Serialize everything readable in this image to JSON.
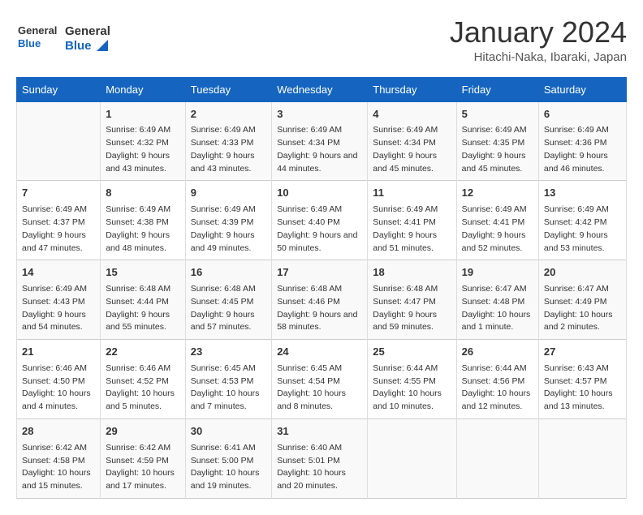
{
  "header": {
    "logo_general": "General",
    "logo_blue": "Blue",
    "month": "January 2024",
    "location": "Hitachi-Naka, Ibaraki, Japan"
  },
  "days_of_week": [
    "Sunday",
    "Monday",
    "Tuesday",
    "Wednesday",
    "Thursday",
    "Friday",
    "Saturday"
  ],
  "weeks": [
    [
      {
        "day": "",
        "sunrise": "",
        "sunset": "",
        "daylight": ""
      },
      {
        "day": "1",
        "sunrise": "Sunrise: 6:49 AM",
        "sunset": "Sunset: 4:32 PM",
        "daylight": "Daylight: 9 hours and 43 minutes."
      },
      {
        "day": "2",
        "sunrise": "Sunrise: 6:49 AM",
        "sunset": "Sunset: 4:33 PM",
        "daylight": "Daylight: 9 hours and 43 minutes."
      },
      {
        "day": "3",
        "sunrise": "Sunrise: 6:49 AM",
        "sunset": "Sunset: 4:34 PM",
        "daylight": "Daylight: 9 hours and 44 minutes."
      },
      {
        "day": "4",
        "sunrise": "Sunrise: 6:49 AM",
        "sunset": "Sunset: 4:34 PM",
        "daylight": "Daylight: 9 hours and 45 minutes."
      },
      {
        "day": "5",
        "sunrise": "Sunrise: 6:49 AM",
        "sunset": "Sunset: 4:35 PM",
        "daylight": "Daylight: 9 hours and 45 minutes."
      },
      {
        "day": "6",
        "sunrise": "Sunrise: 6:49 AM",
        "sunset": "Sunset: 4:36 PM",
        "daylight": "Daylight: 9 hours and 46 minutes."
      }
    ],
    [
      {
        "day": "7",
        "sunrise": "Sunrise: 6:49 AM",
        "sunset": "Sunset: 4:37 PM",
        "daylight": "Daylight: 9 hours and 47 minutes."
      },
      {
        "day": "8",
        "sunrise": "Sunrise: 6:49 AM",
        "sunset": "Sunset: 4:38 PM",
        "daylight": "Daylight: 9 hours and 48 minutes."
      },
      {
        "day": "9",
        "sunrise": "Sunrise: 6:49 AM",
        "sunset": "Sunset: 4:39 PM",
        "daylight": "Daylight: 9 hours and 49 minutes."
      },
      {
        "day": "10",
        "sunrise": "Sunrise: 6:49 AM",
        "sunset": "Sunset: 4:40 PM",
        "daylight": "Daylight: 9 hours and 50 minutes."
      },
      {
        "day": "11",
        "sunrise": "Sunrise: 6:49 AM",
        "sunset": "Sunset: 4:41 PM",
        "daylight": "Daylight: 9 hours and 51 minutes."
      },
      {
        "day": "12",
        "sunrise": "Sunrise: 6:49 AM",
        "sunset": "Sunset: 4:41 PM",
        "daylight": "Daylight: 9 hours and 52 minutes."
      },
      {
        "day": "13",
        "sunrise": "Sunrise: 6:49 AM",
        "sunset": "Sunset: 4:42 PM",
        "daylight": "Daylight: 9 hours and 53 minutes."
      }
    ],
    [
      {
        "day": "14",
        "sunrise": "Sunrise: 6:49 AM",
        "sunset": "Sunset: 4:43 PM",
        "daylight": "Daylight: 9 hours and 54 minutes."
      },
      {
        "day": "15",
        "sunrise": "Sunrise: 6:48 AM",
        "sunset": "Sunset: 4:44 PM",
        "daylight": "Daylight: 9 hours and 55 minutes."
      },
      {
        "day": "16",
        "sunrise": "Sunrise: 6:48 AM",
        "sunset": "Sunset: 4:45 PM",
        "daylight": "Daylight: 9 hours and 57 minutes."
      },
      {
        "day": "17",
        "sunrise": "Sunrise: 6:48 AM",
        "sunset": "Sunset: 4:46 PM",
        "daylight": "Daylight: 9 hours and 58 minutes."
      },
      {
        "day": "18",
        "sunrise": "Sunrise: 6:48 AM",
        "sunset": "Sunset: 4:47 PM",
        "daylight": "Daylight: 9 hours and 59 minutes."
      },
      {
        "day": "19",
        "sunrise": "Sunrise: 6:47 AM",
        "sunset": "Sunset: 4:48 PM",
        "daylight": "Daylight: 10 hours and 1 minute."
      },
      {
        "day": "20",
        "sunrise": "Sunrise: 6:47 AM",
        "sunset": "Sunset: 4:49 PM",
        "daylight": "Daylight: 10 hours and 2 minutes."
      }
    ],
    [
      {
        "day": "21",
        "sunrise": "Sunrise: 6:46 AM",
        "sunset": "Sunset: 4:50 PM",
        "daylight": "Daylight: 10 hours and 4 minutes."
      },
      {
        "day": "22",
        "sunrise": "Sunrise: 6:46 AM",
        "sunset": "Sunset: 4:52 PM",
        "daylight": "Daylight: 10 hours and 5 minutes."
      },
      {
        "day": "23",
        "sunrise": "Sunrise: 6:45 AM",
        "sunset": "Sunset: 4:53 PM",
        "daylight": "Daylight: 10 hours and 7 minutes."
      },
      {
        "day": "24",
        "sunrise": "Sunrise: 6:45 AM",
        "sunset": "Sunset: 4:54 PM",
        "daylight": "Daylight: 10 hours and 8 minutes."
      },
      {
        "day": "25",
        "sunrise": "Sunrise: 6:44 AM",
        "sunset": "Sunset: 4:55 PM",
        "daylight": "Daylight: 10 hours and 10 minutes."
      },
      {
        "day": "26",
        "sunrise": "Sunrise: 6:44 AM",
        "sunset": "Sunset: 4:56 PM",
        "daylight": "Daylight: 10 hours and 12 minutes."
      },
      {
        "day": "27",
        "sunrise": "Sunrise: 6:43 AM",
        "sunset": "Sunset: 4:57 PM",
        "daylight": "Daylight: 10 hours and 13 minutes."
      }
    ],
    [
      {
        "day": "28",
        "sunrise": "Sunrise: 6:42 AM",
        "sunset": "Sunset: 4:58 PM",
        "daylight": "Daylight: 10 hours and 15 minutes."
      },
      {
        "day": "29",
        "sunrise": "Sunrise: 6:42 AM",
        "sunset": "Sunset: 4:59 PM",
        "daylight": "Daylight: 10 hours and 17 minutes."
      },
      {
        "day": "30",
        "sunrise": "Sunrise: 6:41 AM",
        "sunset": "Sunset: 5:00 PM",
        "daylight": "Daylight: 10 hours and 19 minutes."
      },
      {
        "day": "31",
        "sunrise": "Sunrise: 6:40 AM",
        "sunset": "Sunset: 5:01 PM",
        "daylight": "Daylight: 10 hours and 20 minutes."
      },
      {
        "day": "",
        "sunrise": "",
        "sunset": "",
        "daylight": ""
      },
      {
        "day": "",
        "sunrise": "",
        "sunset": "",
        "daylight": ""
      },
      {
        "day": "",
        "sunrise": "",
        "sunset": "",
        "daylight": ""
      }
    ]
  ]
}
